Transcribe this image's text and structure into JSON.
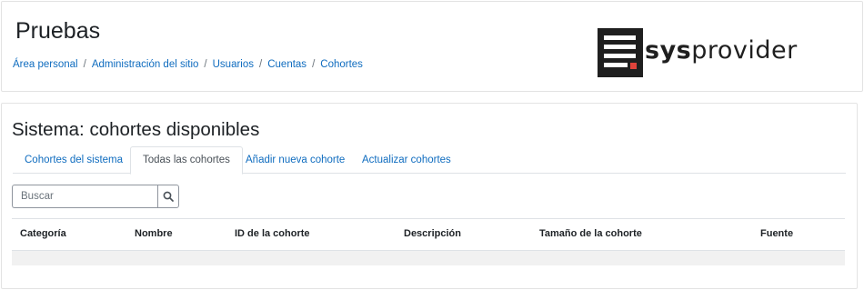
{
  "header": {
    "title": "Pruebas",
    "breadcrumb": [
      "Área personal",
      "Administración del sitio",
      "Usuarios",
      "Cuentas",
      "Cohortes"
    ],
    "logo_text_bold": "sys",
    "logo_text_rest": "provider"
  },
  "main": {
    "title": "Sistema: cohortes disponibles",
    "tabs": [
      {
        "label": "Cohortes del sistema",
        "active": false
      },
      {
        "label": "Todas las cohortes",
        "active": true
      },
      {
        "label": "Añadir nueva cohorte",
        "active": false
      },
      {
        "label": "Actualizar cohortes",
        "active": false
      }
    ],
    "search": {
      "placeholder": "Buscar",
      "value": "",
      "icon": "search-icon"
    },
    "table": {
      "columns": [
        "Categoría",
        "Nombre",
        "ID de la cohorte",
        "Descripción",
        "Tamaño de la cohorte",
        "Fuente"
      ],
      "rows": []
    }
  },
  "colors": {
    "link": "#0f6cbf",
    "text": "#1d2125",
    "logo_dark": "#1f1f1f",
    "logo_accent": "#e0433b"
  }
}
